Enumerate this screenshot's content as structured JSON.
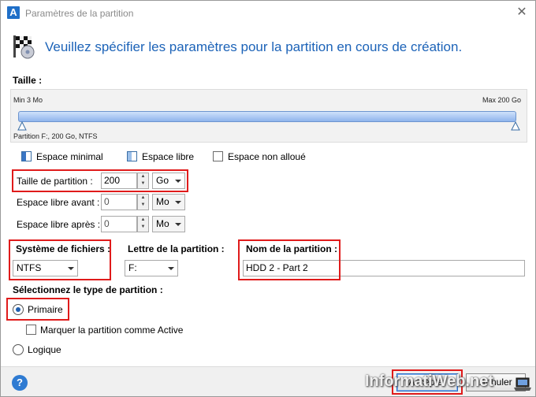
{
  "window": {
    "title": "Paramètres de la partition",
    "app_icon_letter": "A",
    "close_glyph": "✕"
  },
  "header": {
    "text": "Veuillez spécifier les paramètres pour la partition en cours de création."
  },
  "size_section": {
    "label": "Taille :",
    "min_label": "Min 3 Mo",
    "max_label": "Max 200 Go",
    "partition_info": "Partition F:, 200 Go, NTFS"
  },
  "legend": {
    "minimal": "Espace minimal",
    "free": "Espace libre",
    "unallocated": "Espace non alloué"
  },
  "fields": {
    "partition_size": {
      "label": "Taille de partition :",
      "value": "200",
      "unit": "Go"
    },
    "free_before": {
      "label": "Espace libre avant :",
      "value": "0",
      "unit": "Mo"
    },
    "free_after": {
      "label": "Espace libre après :",
      "value": "0",
      "unit": "Mo"
    }
  },
  "filesystem": {
    "label": "Système de fichiers :",
    "value": "NTFS"
  },
  "drive_letter": {
    "label": "Lettre de la partition :",
    "value": "F:"
  },
  "partition_name": {
    "label": "Nom de la partition :",
    "value": "HDD 2 - Part 2"
  },
  "partition_type": {
    "label": "Sélectionnez le type de partition :",
    "primary": "Primaire",
    "mark_active": "Marquer la partition comme Active",
    "logical": "Logique",
    "selected": "primary"
  },
  "footer": {
    "help_glyph": "?",
    "accept_label": "Accepter",
    "cancel_label": "Annuler",
    "watermark": "InformatiWeb.net"
  },
  "colors": {
    "accent": "#1c63b8",
    "highlight_red": "#e01b1b",
    "bar_blue": "#8fb4ec"
  }
}
